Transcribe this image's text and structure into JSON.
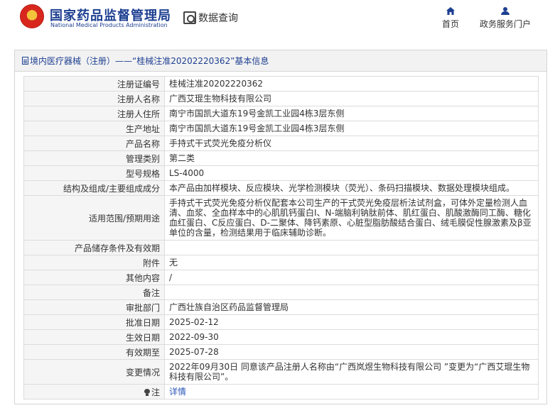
{
  "header": {
    "brand_cn": "国家药品监督管理局",
    "brand_en": "National Medical Products Administration",
    "data_query": "数据查询",
    "nav": [
      {
        "label": "首页",
        "icon": "home-icon"
      },
      {
        "label": "政务服务门户",
        "icon": "user-icon"
      }
    ]
  },
  "panel": {
    "title": "境内医疗器械（注册）——“桂械注准20202220362”基本信息"
  },
  "rows": [
    {
      "label": "注册证编号",
      "value": "桂械注准20202220362"
    },
    {
      "label": "注册人名称",
      "value": "广西艾琨生物科技有限公司"
    },
    {
      "label": "注册人住所",
      "value": "南宁市国凯大道东19号金凯工业园4栋3层东侧"
    },
    {
      "label": "生产地址",
      "value": "南宁市国凯大道东19号金凯工业园4栋3层东侧"
    },
    {
      "label": "产品名称",
      "value": "手持式干式荧光免疫分析仪"
    },
    {
      "label": "管理类别",
      "value": "第二类"
    },
    {
      "label": "型号规格",
      "value": "LS-4000"
    },
    {
      "label": "结构及组成/主要组成成分",
      "value": "本产品由加样模块、反应模块、光学检测模块（荧光）、条码扫描模块、数据处理模块组成。"
    },
    {
      "label": "适用范围/预期用途",
      "value": "手持式干式荧光免疫分析仪配套本公司生产的干式荧光免疫层析法试剂盒，可体外定量检测人血清、血浆、全血样本中的心肌肌钙蛋白I、N-端脑利钠肽前体、肌红蛋白、肌酸激酶同工酶、糖化血红蛋白、C反应蛋白、D-二聚体、降钙素原、心脏型脂肪酸结合蛋白、绒毛膜促性腺激素及β亚单位的含量，检测结果用于临床辅助诊断。"
    },
    {
      "label": "产品储存条件及有效期",
      "value": ""
    },
    {
      "label": "附件",
      "value": "无"
    },
    {
      "label": "其他内容",
      "value": "/"
    },
    {
      "label": "备注",
      "value": ""
    },
    {
      "label": "审批部门",
      "value": "广西壮族自治区药品监督管理局"
    },
    {
      "label": "批准日期",
      "value": "2025-02-12"
    },
    {
      "label": "生效日期",
      "value": "2022-09-30"
    },
    {
      "label": "有效期至",
      "value": "2025-07-28"
    },
    {
      "label": "变更情况",
      "value": "2022年09月30日 同意该产品注册人名称由“广西岚煜生物科技有限公司 ”变更为“广西艾琨生物科技有限公司”。"
    },
    {
      "label": "注",
      "value": "详情"
    }
  ]
}
